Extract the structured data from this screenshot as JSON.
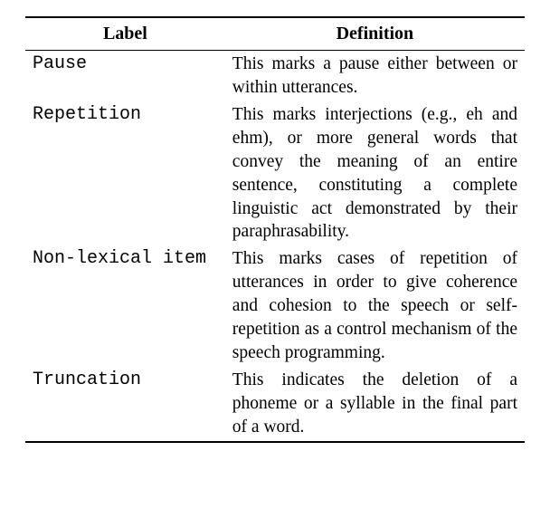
{
  "headers": {
    "label": "Label",
    "definition": "Definition"
  },
  "rows": [
    {
      "label": "Pause",
      "definition": "This marks a pause either be­tween or within utterances."
    },
    {
      "label": "Repetition",
      "definition": "This marks interjections (e.g., eh and ehm), or more general words that convey the mean­ing of an entire sentence, con­stituting a complete linguistic act demonstrated by their para­phrasability."
    },
    {
      "label": "Non-lexical item",
      "definition": "This marks cases of repeti­tion of utterances in order to give coherence and cohesion to the speech or self-repetition as a control mechanism of the speech programming."
    },
    {
      "label": "Truncation",
      "definition": "This indicates the deletion of a phoneme or a syllable in the final part of a word."
    }
  ]
}
